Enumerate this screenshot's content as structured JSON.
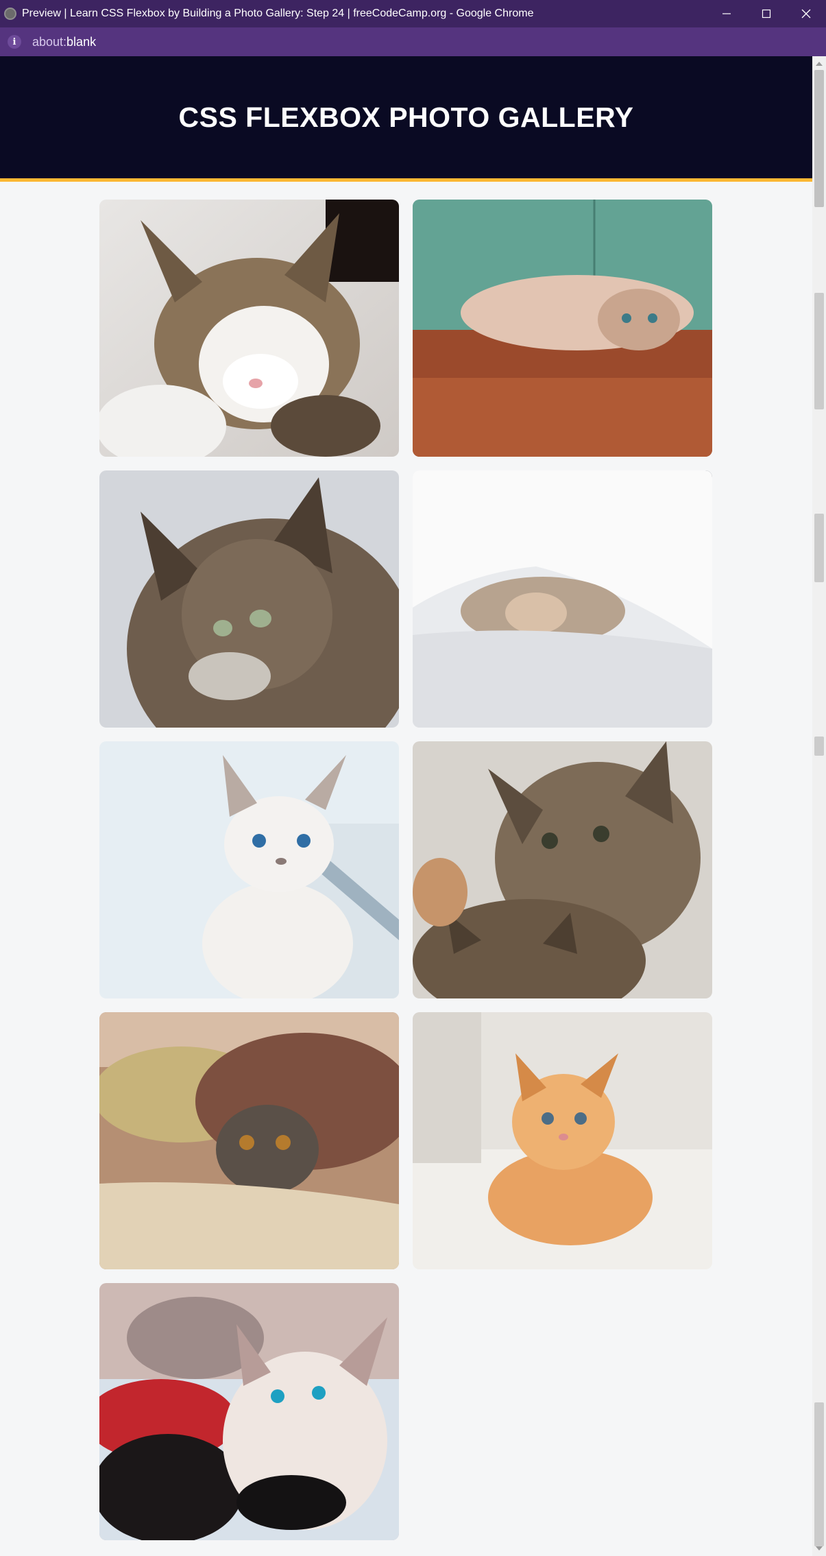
{
  "window": {
    "title": "Preview | Learn CSS Flexbox by Building a Photo Gallery: Step 24 | freeCodeCamp.org - Google Chrome",
    "minimize_glyph": "—",
    "maximize_glyph": "☐",
    "close_glyph": "✕"
  },
  "address_bar": {
    "scheme": "about:",
    "path": "blank",
    "icon": "info-icon"
  },
  "page": {
    "heading": "CSS FLEXBOX PHOTO GALLERY",
    "colors": {
      "header_bg": "#0a0a23",
      "header_border": "#fdb833",
      "page_bg": "#f5f6f7"
    }
  },
  "gallery": {
    "photos": [
      {
        "name": "sleeping-tabby-white-cat-photo"
      },
      {
        "name": "cat-lying-on-wood-floor-photo"
      },
      {
        "name": "long-haired-tabby-cat-photo"
      },
      {
        "name": "cat-under-white-blanket-photo"
      },
      {
        "name": "white-blue-eyed-kitten-photo"
      },
      {
        "name": "two-tabby-kittens-photo"
      },
      {
        "name": "tabby-kitten-under-rug-photo"
      },
      {
        "name": "orange-kitten-lying-photo"
      },
      {
        "name": "kittens-with-blue-eyes-photo"
      }
    ]
  }
}
